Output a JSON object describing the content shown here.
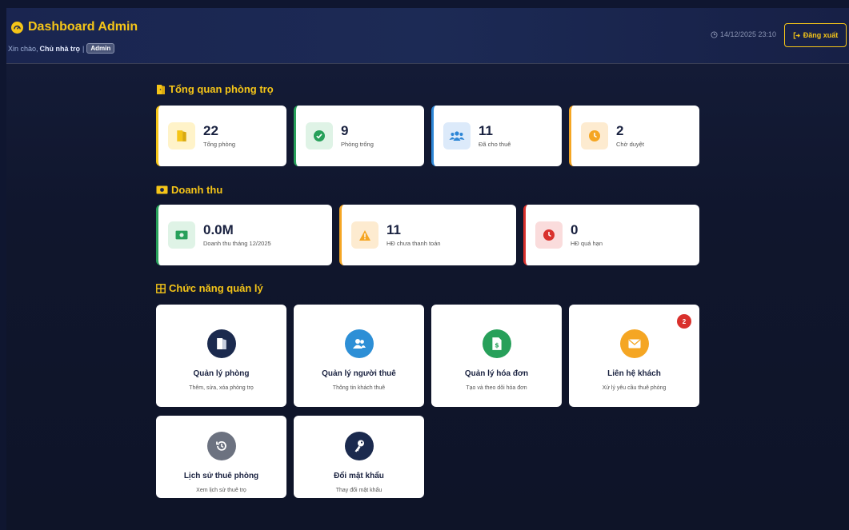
{
  "header": {
    "title": "Dashboard Admin",
    "greeting": "Xin chào,",
    "user_name": "Chủ nhà trọ",
    "separator": "|",
    "role": "Admin",
    "datetime": "14/12/2025 23:10",
    "logout_label": "Đăng xuất"
  },
  "overview": {
    "title": "Tổng quan phòng trọ",
    "stats": [
      {
        "value": "22",
        "label": "Tổng phòng",
        "color": "#f5c518"
      },
      {
        "value": "9",
        "label": "Phòng trống",
        "color": "#27a05a"
      },
      {
        "value": "11",
        "label": "Đã cho thuê",
        "color": "#2d86d6"
      },
      {
        "value": "2",
        "label": "Chờ duyệt",
        "color": "#f5a623"
      }
    ]
  },
  "revenue": {
    "title": "Doanh thu",
    "stats": [
      {
        "value": "0.0M",
        "label": "Doanh thu tháng 12/2025",
        "color": "#27a05a"
      },
      {
        "value": "11",
        "label": "HĐ chưa thanh toán",
        "color": "#f5a623"
      },
      {
        "value": "0",
        "label": "HĐ quá hạn",
        "color": "#d9302c"
      }
    ]
  },
  "features": {
    "title": "Chức năng quản lý",
    "items": [
      {
        "title": "Quản lý phòng",
        "desc": "Thêm, sửa, xóa phòng trọ",
        "icon": "door-icon",
        "color": "#1b2a4e"
      },
      {
        "title": "Quản lý người thuê",
        "desc": "Thông tin khách thuê",
        "icon": "users-icon",
        "color": "#2d8fd6"
      },
      {
        "title": "Quản lý hóa đơn",
        "desc": "Tạo và theo dõi hóa đơn",
        "icon": "invoice-icon",
        "color": "#27a05a"
      },
      {
        "title": "Liên hệ khách",
        "desc": "Xử lý yêu cầu thuê phòng",
        "icon": "envelope-icon",
        "color": "#f5a623",
        "badge": "2"
      },
      {
        "title": "Lịch sử thuê phòng",
        "desc": "Xem lịch sử thuê trọ",
        "icon": "history-icon",
        "color": "#6c7280"
      },
      {
        "title": "Đổi mật khẩu",
        "desc": "Thay đổi mật khẩu",
        "icon": "key-icon",
        "color": "#1b2a4e"
      }
    ]
  }
}
